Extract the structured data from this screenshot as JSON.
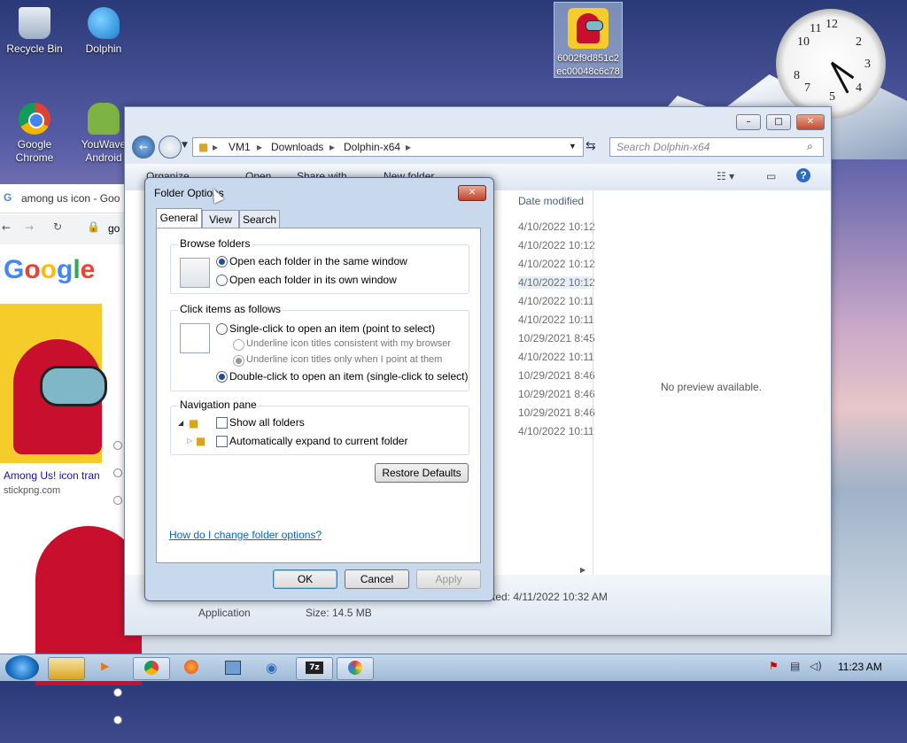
{
  "desktop": {
    "icons": [
      {
        "label": "Recycle Bin"
      },
      {
        "label": "Dolphin"
      },
      {
        "label": "6002f9d851c2 ec00048c6c78"
      },
      {
        "label": "Google Chrome"
      },
      {
        "label": "YouWave Android"
      }
    ]
  },
  "chrome": {
    "tab_title": "among us icon - Goo",
    "search_partial": "go",
    "result_caption": "Among Us! icon tran",
    "result_source": "stickpng.com"
  },
  "explorer": {
    "address": {
      "crumbs": [
        "VM1",
        "Downloads",
        "Dolphin-x64"
      ]
    },
    "search_placeholder": "Search Dolphin-x64",
    "toolbar": {
      "organize": "Organize",
      "open": "Open",
      "share": "Share with",
      "new_folder": "New folder"
    },
    "column_date": "Date modified",
    "dates": [
      "4/10/2022 10:12",
      "4/10/2022 10:12",
      "4/10/2022 10:12",
      "4/10/2022 10:12",
      "4/10/2022 10:11",
      "4/10/2022 10:11",
      "10/29/2021 8:45",
      "4/10/2022 10:11",
      "10/29/2021 8:46",
      "10/29/2021 8:46",
      "10/29/2021 8:46",
      "4/10/2022 10:11"
    ],
    "preview_text": "No preview available.",
    "details": {
      "type": "Application",
      "size": "Size: 14.5 MB",
      "created": "ted: 4/11/2022 10:32 AM"
    }
  },
  "dialog": {
    "title": "Folder Options",
    "tabs": [
      "General",
      "View",
      "Search"
    ],
    "browse_folders": {
      "title": "Browse folders",
      "options": [
        "Open each folder in the same window",
        "Open each folder in its own window"
      ],
      "selected": 0
    },
    "click_items": {
      "title": "Click items as follows",
      "single": "Single-click to open an item (point to select)",
      "underline_browser": "Underline icon titles consistent with my browser",
      "underline_point": "Underline icon titles only when I point at them",
      "double": "Double-click to open an item (single-click to select)"
    },
    "nav_pane": {
      "title": "Navigation pane",
      "show_all": "Show all folders",
      "auto_expand": "Automatically expand to current folder"
    },
    "restore_defaults": "Restore Defaults",
    "help_link": "How do I change folder options?",
    "buttons": {
      "ok": "OK",
      "cancel": "Cancel",
      "apply": "Apply"
    }
  },
  "taskbar": {
    "time": "11:23 AM"
  }
}
